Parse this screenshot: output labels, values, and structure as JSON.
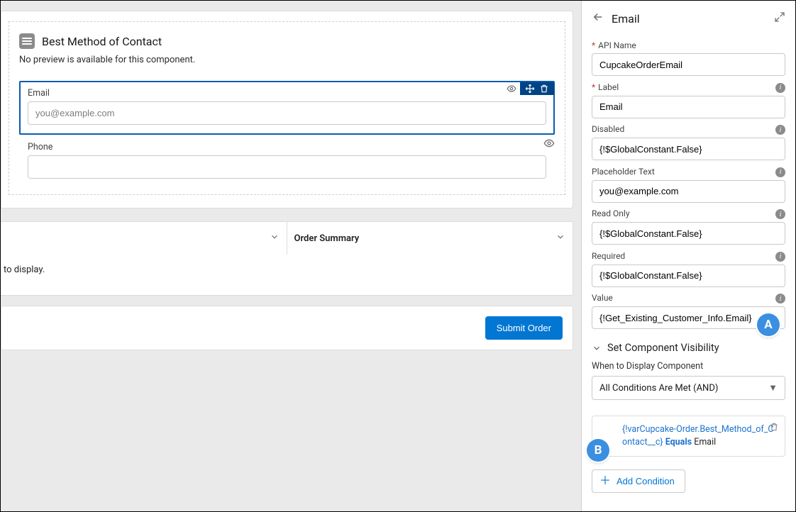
{
  "canvas": {
    "section_title": "Best Method of Contact",
    "no_preview": "No preview is available for this component.",
    "chip_label": "Email",
    "email": {
      "label": "Email",
      "placeholder": "you@example.com"
    },
    "phone": {
      "label": "Phone"
    },
    "summary_heading": "Order Summary",
    "to_display": "to display.",
    "submit_label": "Submit Order"
  },
  "sidebar": {
    "title": "Email",
    "api_name": {
      "label": "API Name",
      "value": "CupcakeOrderEmail"
    },
    "label_f": {
      "label": "Label",
      "value": "Email"
    },
    "disabled": {
      "label": "Disabled",
      "value": "{!$GlobalConstant.False}"
    },
    "placeholder": {
      "label": "Placeholder Text",
      "value": "you@example.com"
    },
    "readonly": {
      "label": "Read Only",
      "value": "{!$GlobalConstant.False}"
    },
    "required": {
      "label": "Required",
      "value": "{!$GlobalConstant.False}"
    },
    "value_f": {
      "label": "Value",
      "value": "{!Get_Existing_Customer_Info.Email}"
    },
    "visibility_heading": "Set Component Visibility",
    "when_label": "When to Display Component",
    "when_value": "All Conditions Are Met (AND)",
    "condition_a": "{!varCupcake-Order.Best_Method_of_Contact__c}",
    "condition_op": "Equals",
    "condition_val": "Email",
    "add_condition": "Add Condition"
  },
  "annotations": {
    "A": "A",
    "B": "B"
  }
}
